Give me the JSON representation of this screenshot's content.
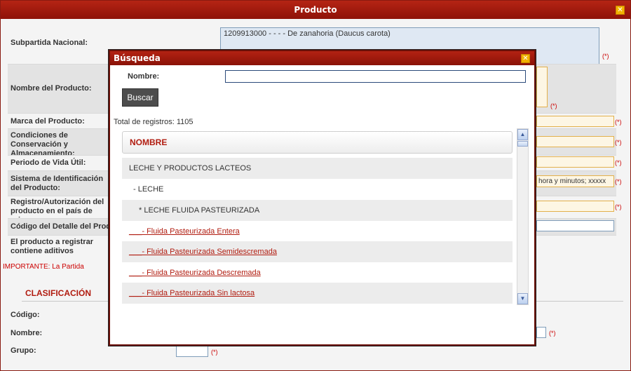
{
  "window": {
    "title": "Producto",
    "close_icon": "close-icon",
    "required_mark": "(*)",
    "subpartida": {
      "label": "Subpartida Nacional:",
      "value": "1209913000 - - - - De zanahoria (Daucus carota)"
    },
    "fields": [
      {
        "label": "Nombre del Producto:"
      },
      {
        "label": "Marca del Producto:"
      },
      {
        "label": "Condiciones de Conservación y Almacenamiento:"
      },
      {
        "label": "Periodo de Vida Útil:"
      },
      {
        "label": "Sistema de Identificación del Producto:",
        "value": "hora y minutos; xxxxx"
      },
      {
        "label": "Registro/Autorización del producto en el país de origen:"
      },
      {
        "label": "Código del Detalle del Producto:"
      },
      {
        "label": "El producto a registrar contiene aditivos"
      }
    ],
    "important_note": "IMPORTANTE: La Partida",
    "clasificacion": {
      "title": "CLASIFICACIÓN",
      "codigo_label": "Código:",
      "nombre_label": "Nombre:",
      "grupo_label": "Grupo:"
    }
  },
  "modal": {
    "title": "Búsqueda",
    "nombre_label": "Nombre:",
    "nombre_value": "",
    "buscar_label": "Buscar",
    "total_text": "Total de registros: 1105",
    "column_header": "NOMBRE",
    "rows": [
      {
        "text": "LECHE Y PRODUCTOS LACTEOS",
        "indent": 0,
        "link": false
      },
      {
        "text": "- LECHE",
        "indent": 1,
        "link": false
      },
      {
        "text": "* LECHE FLUIDA PASTEURIZADA",
        "indent": 2,
        "link": false
      },
      {
        "text": "___- Fluida Pasteurizada Entera",
        "indent": 0,
        "link": true
      },
      {
        "text": "___- Fluida Pasteurizada Semidescremada",
        "indent": 0,
        "link": true
      },
      {
        "text": "___- Fluida Pasteurizada Descremada",
        "indent": 0,
        "link": true
      },
      {
        "text": "___- Fluida Pasteurizada Sin lactosa",
        "indent": 0,
        "link": true
      }
    ]
  },
  "colors": {
    "title_bar": "#a81a0d",
    "link": "#b11c10",
    "field_bg": "#fdf6e4",
    "field_border": "#e3b04b"
  }
}
